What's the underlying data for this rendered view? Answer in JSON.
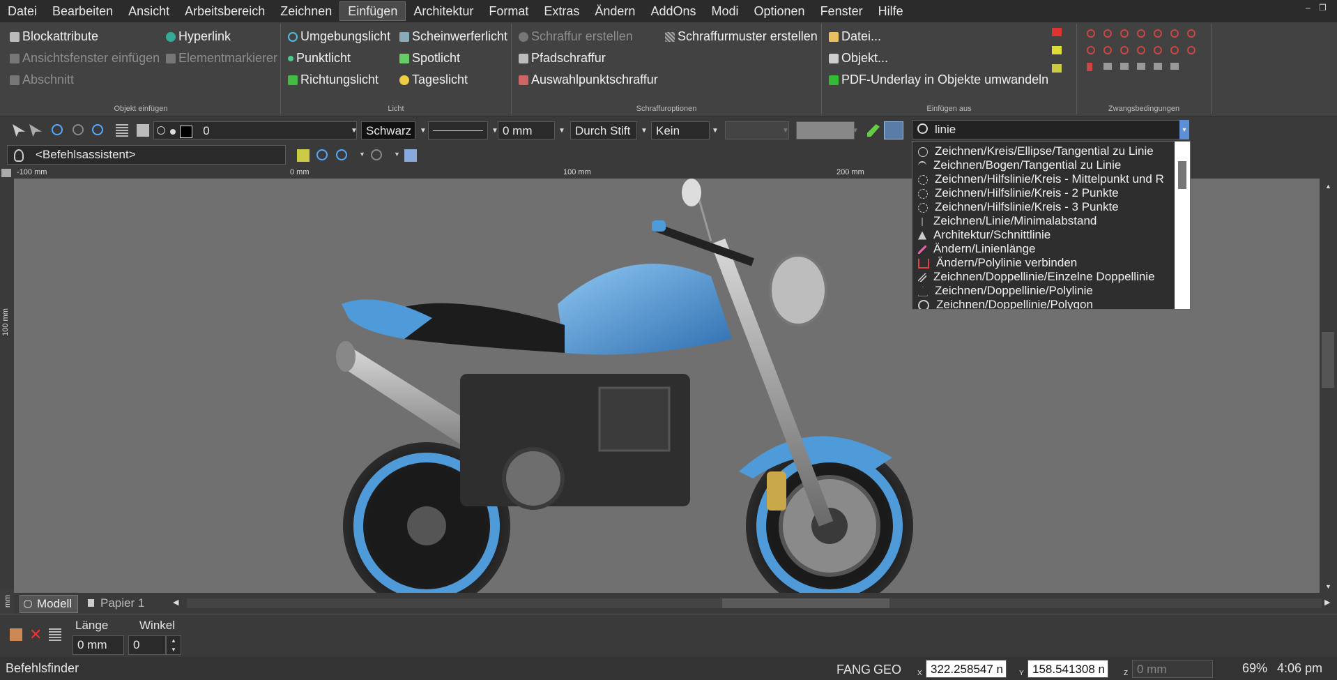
{
  "menubar": {
    "items": [
      "Datei",
      "Bearbeiten",
      "Ansicht",
      "Arbeitsbereich",
      "Zeichnen",
      "Einfügen",
      "Architektur",
      "Format",
      "Extras",
      "Ändern",
      "AddOns",
      "Modi",
      "Optionen",
      "Fenster",
      "Hilfe"
    ],
    "active": "Einfügen"
  },
  "window_controls": {
    "minimize": "–",
    "restore": "❐"
  },
  "ribbon": {
    "objekt_einfuegen": {
      "label": "Objekt einfügen",
      "items": [
        "Blockattribute",
        "Hyperlink",
        "Ansichtsfenster einfügen",
        "Elementmarkierer",
        "Abschnitt"
      ]
    },
    "licht": {
      "label": "Licht",
      "items": [
        "Umgebungslicht",
        "Scheinwerferlicht",
        "Punktlicht",
        "Spotlicht",
        "Richtungslicht",
        "Tageslicht"
      ]
    },
    "schraffur": {
      "label": "Schraffuroptionen",
      "items": [
        "Schraffur erstellen",
        "Schraffurmuster erstellen",
        "Pfadschraffur",
        "Auswahlpunktschraffur"
      ]
    },
    "einfuegen_aus": {
      "label": "Einfügen aus",
      "items": [
        "Datei...",
        "Objekt...",
        "PDF-Underlay in Objekte umwandeln"
      ]
    },
    "zwangsbedingungen": {
      "label": "Zwangsbedingungen"
    }
  },
  "props": {
    "layer": "0",
    "color": "Schwarz",
    "lineweight": "0 mm",
    "plotstyle": "Durch Stift",
    "hatch": "Kein"
  },
  "search": {
    "value": "linie"
  },
  "command_assistant": "<Befehlsassistent>",
  "command_results": [
    "Zeichnen/Kreis/Ellipse/Tangential zu Linie",
    "Zeichnen/Bogen/Tangential zu Linie",
    "Zeichnen/Hilfslinie/Kreis - Mittelpunkt und R",
    "Zeichnen/Hilfslinie/Kreis - 2 Punkte",
    "Zeichnen/Hilfslinie/Kreis - 3 Punkte",
    "Zeichnen/Linie/Minimalabstand",
    "Architektur/Schnittlinie",
    "Ändern/Linienlänge",
    "Ändern/Polylinie verbinden",
    "Zeichnen/Doppellinie/Einzelne Doppellinie",
    "Zeichnen/Doppellinie/Polylinie",
    "Zeichnen/Doppellinie/Polygon"
  ],
  "ruler": {
    "top": [
      "-100 mm",
      "0 mm",
      "100 mm",
      "200 mm"
    ],
    "left": "100 mm",
    "left_bottom": "mm"
  },
  "tabs": [
    "Modell",
    "Papier 1"
  ],
  "inputs": {
    "length_label": "Länge",
    "length_value": "0 mm",
    "angle_label": "Winkel",
    "angle_value": "0"
  },
  "status": {
    "left": "Befehlsfinder",
    "fang": "FANG",
    "geo": "GEO",
    "x_label": "X",
    "x": "322.258547 n",
    "y_label": "Y",
    "y": "158.541308 n",
    "z_label": "Z",
    "z": "0 mm",
    "zoom": "69%",
    "time": "4:06 pm"
  },
  "colors": {
    "accent_blue": "#4a9be0",
    "bike_blue": "#5fa8e6"
  }
}
